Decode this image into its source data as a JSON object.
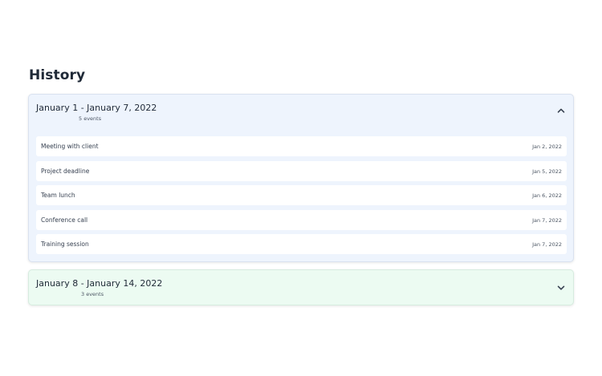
{
  "page": {
    "title": "History"
  },
  "groups": [
    {
      "title": "January 1 - January 7, 2022",
      "count": "5 events",
      "expanded": true,
      "icon": "chevron-up-icon",
      "background": "#eef4fd",
      "events": [
        {
          "name": "Meeting with client",
          "date": "Jan 2, 2022"
        },
        {
          "name": "Project deadline",
          "date": "Jan 5, 2022"
        },
        {
          "name": "Team lunch",
          "date": "Jan 6, 2022"
        },
        {
          "name": "Conference call",
          "date": "Jan 7, 2022"
        },
        {
          "name": "Training session",
          "date": "Jan 7, 2022"
        }
      ]
    },
    {
      "title": "January 8 - January 14, 2022",
      "count": "3 events",
      "expanded": false,
      "icon": "chevron-down-icon",
      "background": "#ecfbf2"
    }
  ]
}
